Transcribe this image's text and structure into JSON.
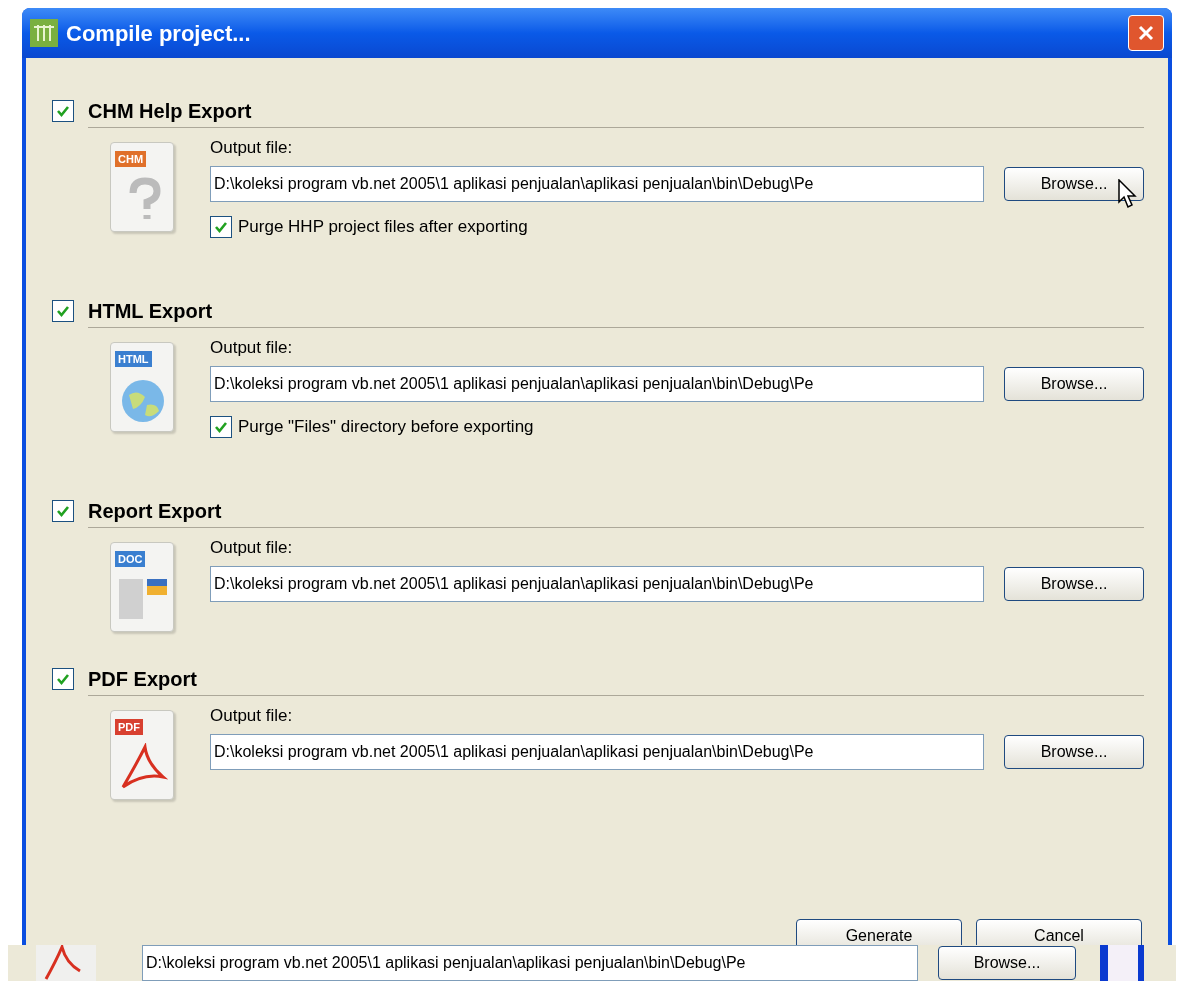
{
  "window": {
    "title": "Compile project..."
  },
  "sections": [
    {
      "title": "CHM Help Export",
      "checked": true,
      "kind": "chm",
      "icon_label": "CHM",
      "output_label": "Output file:",
      "path": "D:\\koleksi program vb.net 2005\\1  aplikasi penjualan\\aplikasi penjualan\\bin\\Debug\\Pe",
      "browse": "Browse...",
      "option": {
        "label": "Purge HHP project files after exporting",
        "checked": true
      }
    },
    {
      "title": "HTML Export",
      "checked": true,
      "kind": "html",
      "icon_label": "HTML",
      "output_label": "Output file:",
      "path": "D:\\koleksi program vb.net 2005\\1  aplikasi penjualan\\aplikasi penjualan\\bin\\Debug\\Pe",
      "browse": "Browse...",
      "option": {
        "label": "Purge \"Files\" directory before exporting",
        "checked": true
      }
    },
    {
      "title": "Report Export",
      "checked": true,
      "kind": "doc",
      "icon_label": "DOC",
      "output_label": "Output file:",
      "path": "D:\\koleksi program vb.net 2005\\1  aplikasi penjualan\\aplikasi penjualan\\bin\\Debug\\Pe",
      "browse": "Browse..."
    },
    {
      "title": "PDF Export",
      "checked": true,
      "kind": "pdf",
      "icon_label": "PDF",
      "output_label": "Output file:",
      "path": "D:\\koleksi program vb.net 2005\\1  aplikasi penjualan\\aplikasi penjualan\\bin\\Debug\\Pe",
      "browse": "Browse..."
    }
  ],
  "buttons": [
    "Generate",
    "Cancel"
  ],
  "background_window": {
    "path": "D:\\koleksi program vb.net 2005\\1  aplikasi penjualan\\aplikasi penjualan\\bin\\Debug\\Pe",
    "browse": "Browse..."
  }
}
